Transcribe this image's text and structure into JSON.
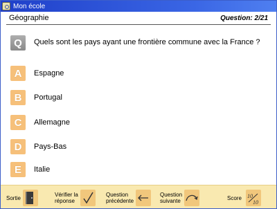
{
  "window": {
    "title": "Mon école"
  },
  "header": {
    "subject": "Géographie",
    "counter": "Question: 2/21"
  },
  "question": {
    "badge": "Q",
    "text": "Quels sont les pays ayant une frontière commune avec la France ?"
  },
  "answers": [
    {
      "letter": "A",
      "text": "Espagne"
    },
    {
      "letter": "B",
      "text": "Portugal"
    },
    {
      "letter": "C",
      "text": "Allemagne"
    },
    {
      "letter": "D",
      "text": "Pays-Bas"
    },
    {
      "letter": "E",
      "text": "Italie"
    }
  ],
  "footer": {
    "exit_label": "Sortie",
    "verify_label_1": "Vérifier la",
    "verify_label_2": "réponse",
    "prev_label_1": "Question",
    "prev_label_2": "précédente",
    "next_label_1": "Question",
    "next_label_2": "suivante",
    "score_label": "Score",
    "score_value": "10/10"
  },
  "colors": {
    "titlebar": "#1f3fc9",
    "letter_tile": "#f6c07a",
    "footer_bg": "#f9e9b0",
    "q_badge": "#9a9a9a"
  }
}
